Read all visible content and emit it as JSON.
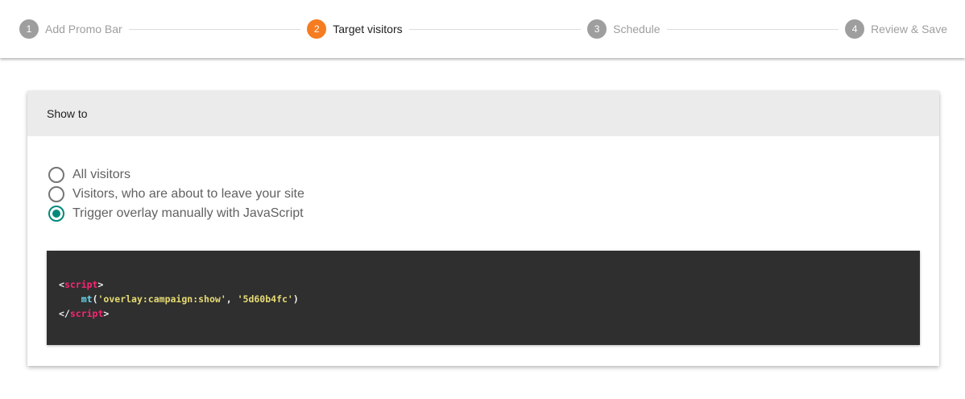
{
  "stepper": {
    "steps": [
      {
        "number": "1",
        "label": "Add Promo Bar",
        "state": "inactive"
      },
      {
        "number": "2",
        "label": "Target visitors",
        "state": "active"
      },
      {
        "number": "3",
        "label": "Schedule",
        "state": "inactive"
      },
      {
        "number": "4",
        "label": "Review & Save",
        "state": "inactive"
      }
    ]
  },
  "card": {
    "title": "Show to",
    "options": [
      {
        "label": "All visitors",
        "checked": false
      },
      {
        "label": "Visitors, who are about to leave your site",
        "checked": false
      },
      {
        "label": "Trigger overlay manually with JavaScript",
        "checked": true
      }
    ],
    "code": {
      "lt": "<",
      "gt": ">",
      "lt_slash": "</",
      "tag": "script",
      "indent": "    ",
      "fn": "mt",
      "open_paren": "(",
      "arg1": "'overlay:campaign:show'",
      "comma": ", ",
      "arg2": "'5d60b4fc'",
      "close_paren": ")"
    }
  },
  "colors": {
    "active_step": "#f57c20",
    "inactive_step": "#9e9e9e",
    "radio_checked": "#00897b",
    "code_background": "#2f2f2f",
    "code_tag": "#f92672",
    "code_function": "#66d9ef",
    "code_string": "#e6db74"
  }
}
